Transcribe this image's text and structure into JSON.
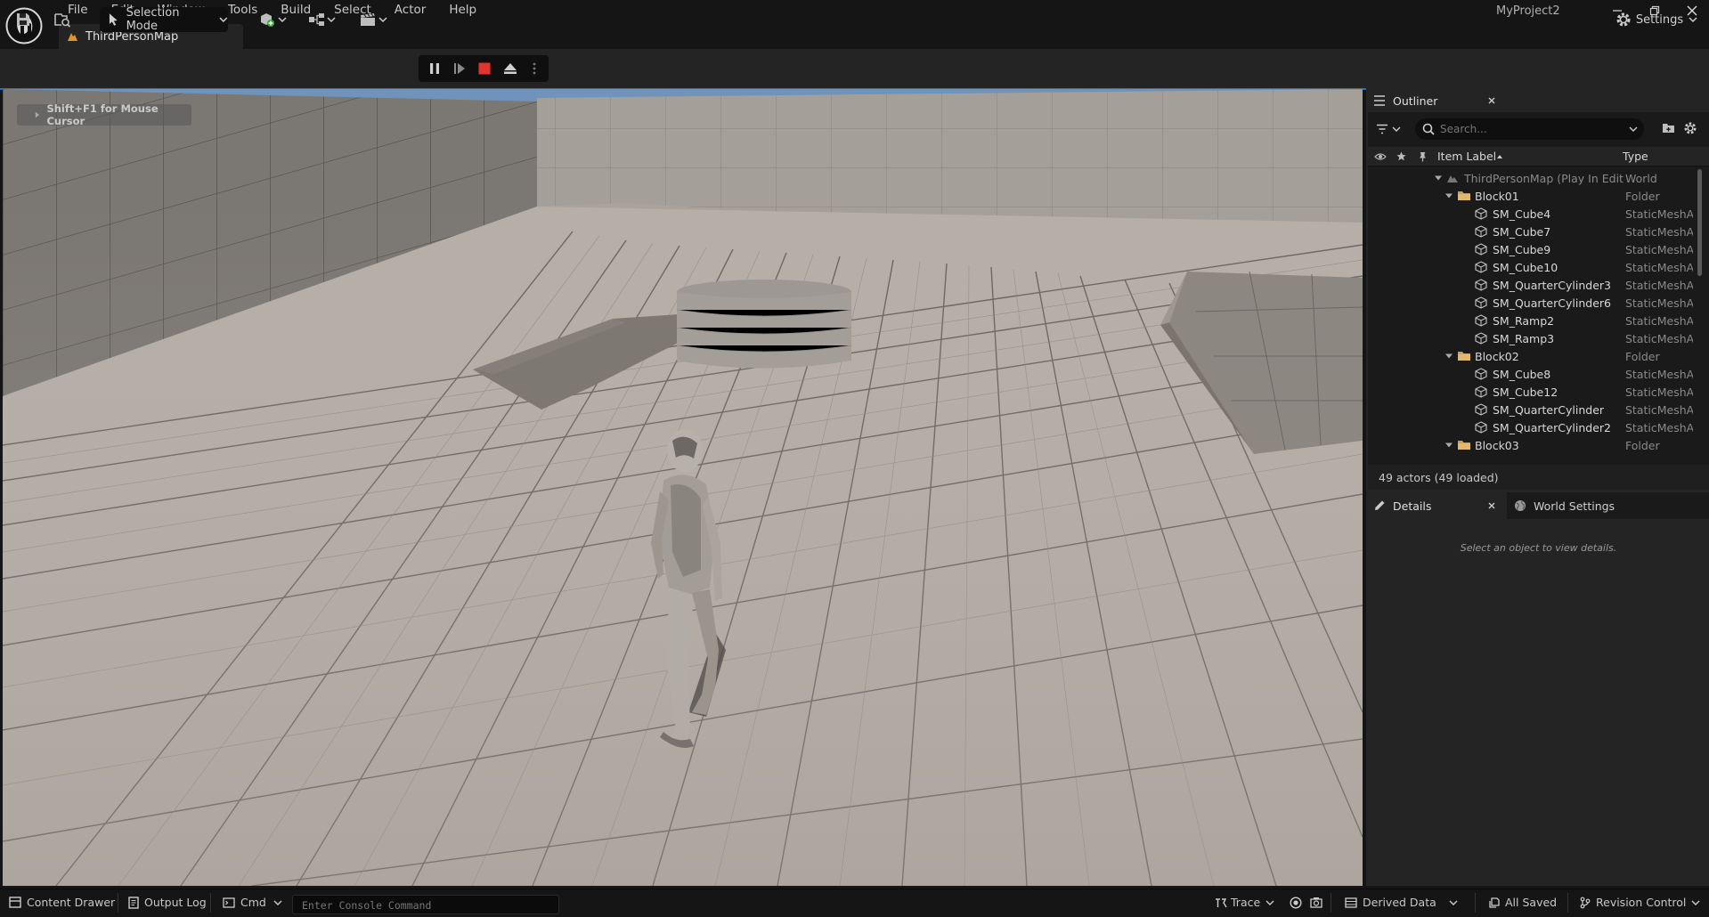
{
  "menu": [
    "File",
    "Edit",
    "Window",
    "Tools",
    "Build",
    "Select",
    "Actor",
    "Help"
  ],
  "project_name": "MyProject2",
  "tab": {
    "label": "ThirdPersonMap"
  },
  "toolbar": {
    "selection_mode": "Selection Mode",
    "settings": "Settings"
  },
  "viewport": {
    "hint": "Shift+F1 for Mouse Cursor"
  },
  "outliner": {
    "title": "Outliner",
    "search_placeholder": "Search...",
    "columns": {
      "label": "Item Label",
      "type": "Type"
    },
    "rows": [
      {
        "name": "ThirdPersonMap (Play In Edit",
        "type": "World",
        "kind": "world",
        "depth": 0
      },
      {
        "name": "Block01",
        "type": "Folder",
        "kind": "folder",
        "depth": 1
      },
      {
        "name": "SM_Cube4",
        "type": "StaticMeshActor",
        "kind": "mesh",
        "depth": 2
      },
      {
        "name": "SM_Cube7",
        "type": "StaticMeshActor",
        "kind": "mesh",
        "depth": 2
      },
      {
        "name": "SM_Cube9",
        "type": "StaticMeshActor",
        "kind": "mesh",
        "depth": 2
      },
      {
        "name": "SM_Cube10",
        "type": "StaticMeshActor",
        "kind": "mesh",
        "depth": 2
      },
      {
        "name": "SM_QuarterCylinder3",
        "type": "StaticMeshActor",
        "kind": "mesh",
        "depth": 2
      },
      {
        "name": "SM_QuarterCylinder6",
        "type": "StaticMeshActor",
        "kind": "mesh",
        "depth": 2
      },
      {
        "name": "SM_Ramp2",
        "type": "StaticMeshActor",
        "kind": "mesh",
        "depth": 2
      },
      {
        "name": "SM_Ramp3",
        "type": "StaticMeshActor",
        "kind": "mesh",
        "depth": 2
      },
      {
        "name": "Block02",
        "type": "Folder",
        "kind": "folder",
        "depth": 1
      },
      {
        "name": "SM_Cube8",
        "type": "StaticMeshActor",
        "kind": "mesh",
        "depth": 2
      },
      {
        "name": "SM_Cube12",
        "type": "StaticMeshActor",
        "kind": "mesh",
        "depth": 2
      },
      {
        "name": "SM_QuarterCylinder",
        "type": "StaticMeshActor",
        "kind": "mesh",
        "depth": 2
      },
      {
        "name": "SM_QuarterCylinder2",
        "type": "StaticMeshActor",
        "kind": "mesh",
        "depth": 2
      },
      {
        "name": "Block03",
        "type": "Folder",
        "kind": "folder",
        "depth": 1
      }
    ],
    "status": "49 actors (49 loaded)"
  },
  "details": {
    "tab_details": "Details",
    "tab_world_settings": "World Settings",
    "empty_message": "Select an object to view details."
  },
  "statusbar": {
    "content_drawer": "Content Drawer",
    "output_log": "Output Log",
    "cmd": "Cmd",
    "console_placeholder": "Enter Console Command",
    "trace": "Trace",
    "derived_data": "Derived Data",
    "all_saved": "All Saved",
    "revision_control": "Revision Control"
  },
  "colors": {
    "stop_red": "#e0342f",
    "folder": "#c9a15a",
    "accent_blue": "#1a73d9"
  }
}
